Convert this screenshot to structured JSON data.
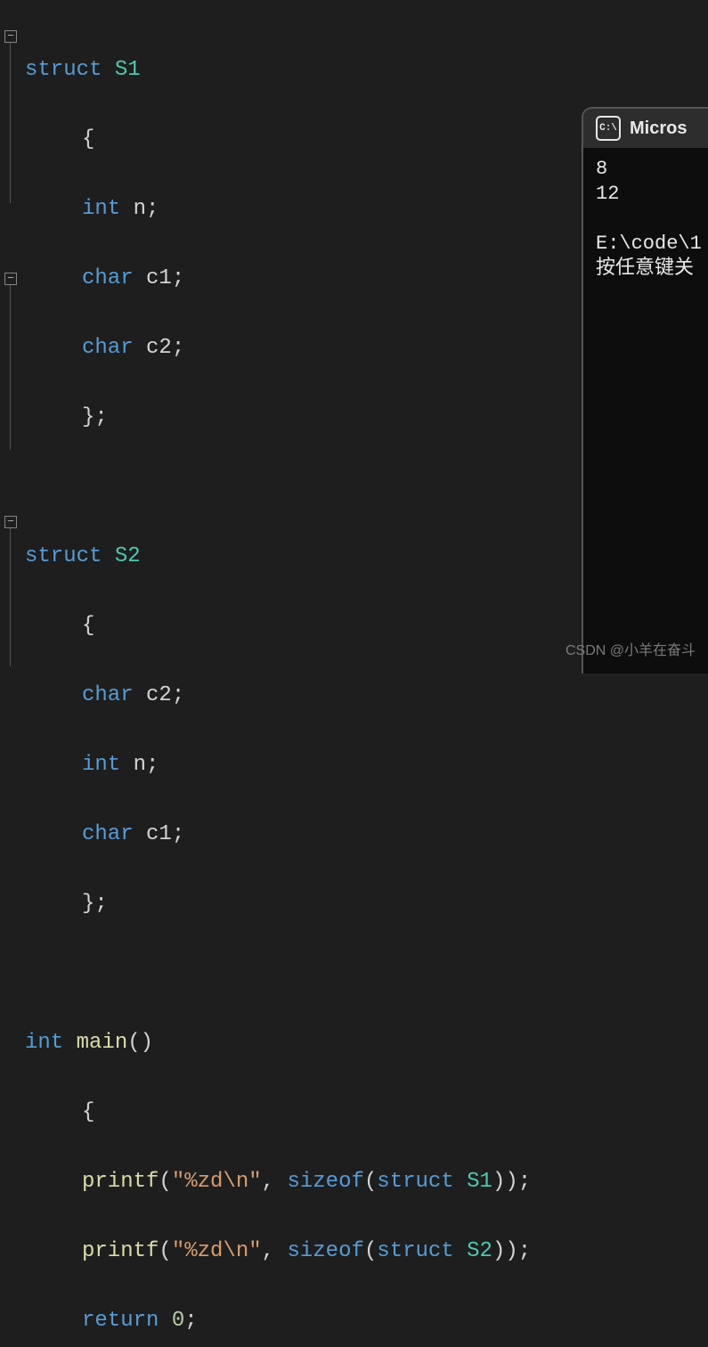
{
  "code": {
    "blocks": [
      {
        "fold": true,
        "tokens": {
          "kw_struct": "struct",
          "name": "S1",
          "brace_open": "{",
          "field1_type": "int",
          "field1_name": "n",
          "semi1": ";",
          "field2_type": "char",
          "field2_name": "c1",
          "semi2": ";",
          "field3_type": "char",
          "field3_name": "c2",
          "semi3": ";",
          "brace_close": "};"
        }
      },
      {
        "fold": true,
        "tokens": {
          "kw_struct": "struct",
          "name": "S2",
          "brace_open": "{",
          "field1_type": "char",
          "field1_name": "c2",
          "semi1": ";",
          "field2_type": "int",
          "field2_name": "n",
          "semi2": ";",
          "field3_type": "char",
          "field3_name": "c1",
          "semi3": ";",
          "brace_close": "};"
        }
      },
      {
        "fold": true,
        "tokens": {
          "ret_type": "int",
          "fn_name": "main",
          "parens": "()",
          "brace_open": "{",
          "call_fn": "printf",
          "arg_fmt": "\"%zd\\n\"",
          "kw_sizeof": "sizeof",
          "kw_struct": "struct",
          "ty1": "S1",
          "ty2": "S2",
          "kw_return": "return",
          "ret_val": "0",
          "comma": ", ",
          "paren_open": "(",
          "paren_close": ")",
          "dparen_close": "))",
          "semi": ";"
        }
      }
    ]
  },
  "terminal": {
    "title": "Micros",
    "icon_glyph": "C:\\",
    "output": [
      "8",
      "12",
      "",
      "E:\\code\\1",
      "按任意键关"
    ]
  },
  "watermark": "CSDN @小羊在奋斗"
}
